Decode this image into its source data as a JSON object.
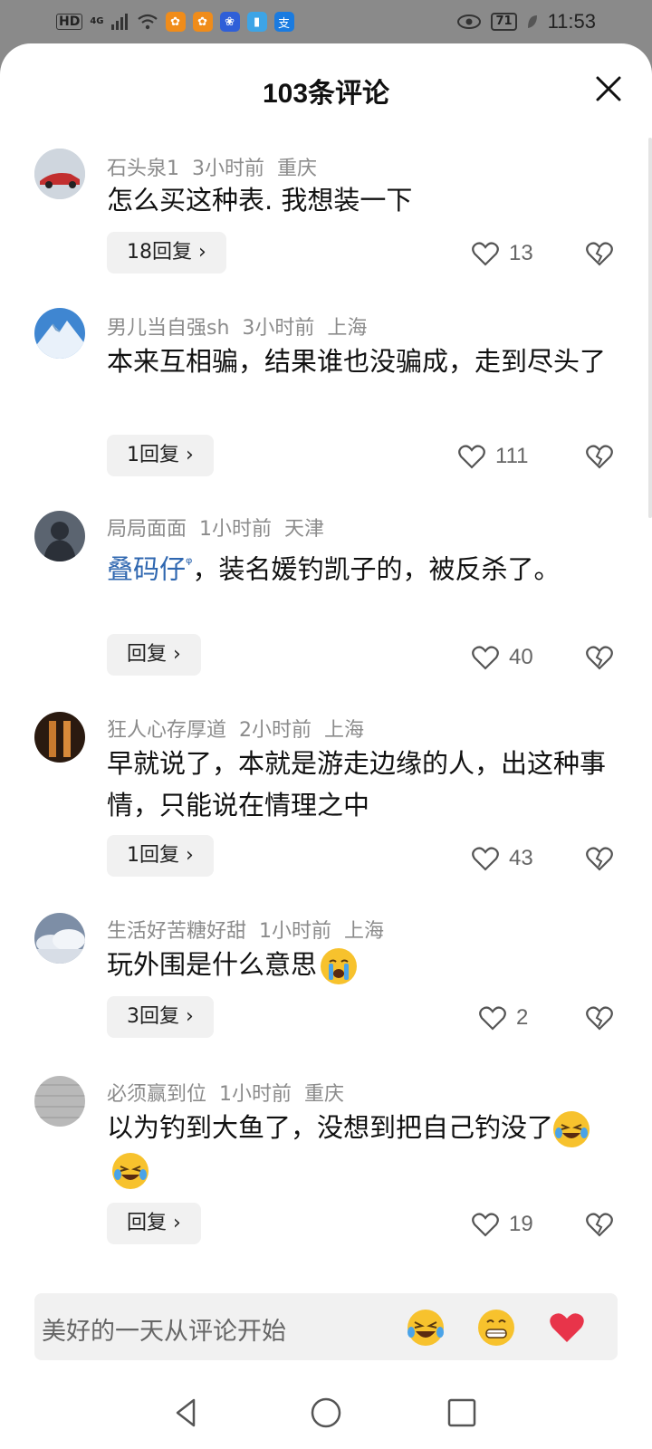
{
  "status_bar": {
    "hd": "HD",
    "network": "4G",
    "battery": "71",
    "time": "11:53",
    "alipay_glyph": "支"
  },
  "sheet": {
    "title": "103条评论"
  },
  "comments": [
    {
      "user": "石头泉1",
      "time": "3小时前",
      "location": "重庆",
      "text": "怎么买这种表. 我想装一下",
      "reply": "18回复 ›",
      "likes": "13",
      "avatar_color": "#b33a3a"
    },
    {
      "user": "男儿当自强sh",
      "time": "3小时前",
      "location": "上海",
      "text": "本来互相骗，结果谁也没骗成，走到尽头了",
      "reply": "1回复 ›",
      "likes": "111",
      "avatar_color": "#3d7fc4"
    },
    {
      "user": "局局面面",
      "time": "1小时前",
      "location": "天津",
      "mention": "叠码仔",
      "mention_icon": "ᵠ",
      "text": "，装名媛钓凯子的，被反杀了。",
      "reply": "回复 ›",
      "likes": "40",
      "avatar_color": "#3b4450"
    },
    {
      "user": "狂人心存厚道",
      "time": "2小时前",
      "location": "上海",
      "text": "早就说了，本就是游走边缘的人，出这种事情，只能说在情理之中",
      "reply": "1回复 ›",
      "likes": "43",
      "avatar_color": "#8a4a1c"
    },
    {
      "user": "生活好苦糖好甜",
      "time": "1小时前",
      "location": "上海",
      "text": "玩外围是什么意思",
      "reply": "3回复 ›",
      "likes": "2",
      "avatar_color": "#9aa6b8"
    },
    {
      "user": "必须赢到位",
      "time": "1小时前",
      "location": "重庆",
      "text": "以为钓到大鱼了，没想到把自己钓没了",
      "reply": "回复 ›",
      "likes": "19",
      "avatar_color": "#b5b5b5"
    }
  ],
  "input": {
    "placeholder": "美好的一天从评论开始"
  },
  "icons": {
    "close": "close-icon",
    "like": "heart-outline-icon",
    "dislike": "broken-heart-icon",
    "emoji_cry": "crying-face-emoji",
    "emoji_laugh": "laughing-tears-emoji",
    "emoji_grin": "grinning-emoji",
    "emoji_heart": "red-heart-emoji"
  },
  "colors": {
    "mention": "#2f67b0",
    "meta": "#8b8b8b",
    "heart": "#e8344a"
  }
}
